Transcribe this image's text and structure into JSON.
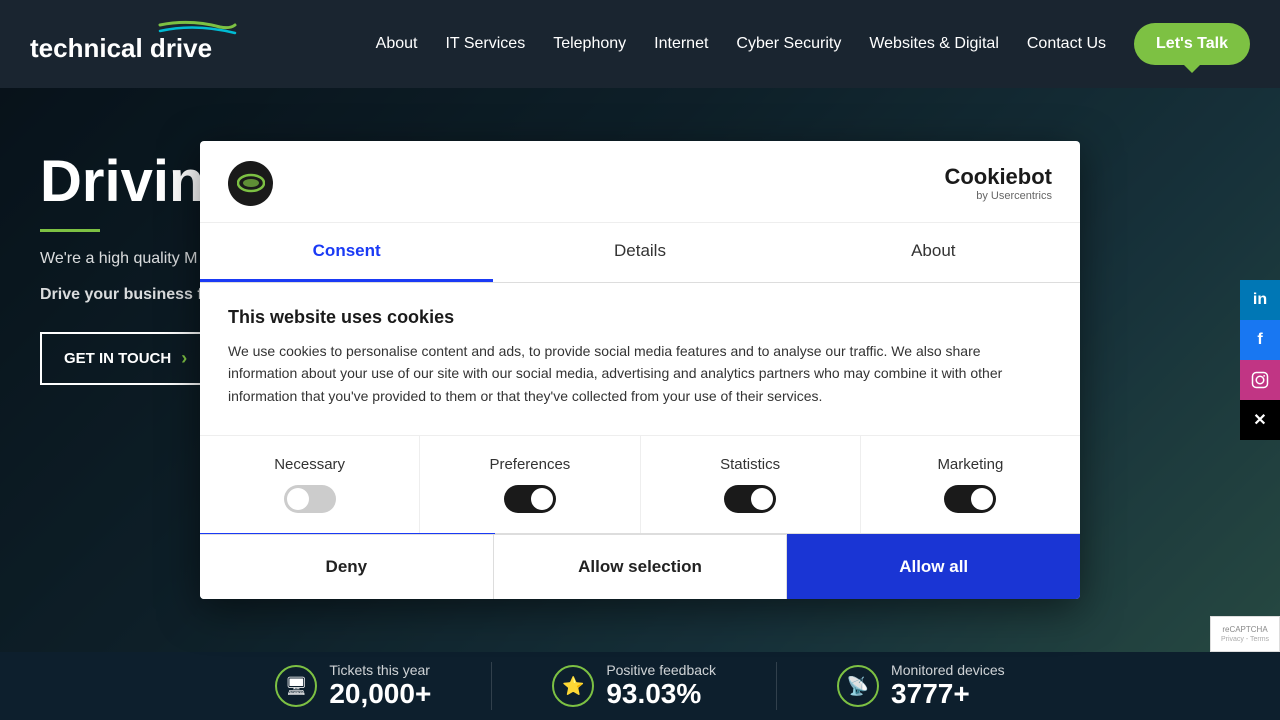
{
  "header": {
    "logo_text": "technical drive",
    "nav_items": [
      "About",
      "IT Services",
      "Telephony",
      "Internet",
      "Cyber Security",
      "Websites & Digital",
      "Contact Us"
    ],
    "cta_button": "Let's Talk"
  },
  "hero": {
    "title": "Driving",
    "description1": "We're a high quality M wide range of IT servi...",
    "description2": "Drive your business f... strategic team.",
    "cta": "GET IN TOUCH"
  },
  "social": {
    "items": [
      {
        "name": "linkedin",
        "icon": "in"
      },
      {
        "name": "facebook",
        "icon": "f"
      },
      {
        "name": "instagram",
        "icon": "◎"
      },
      {
        "name": "twitter-x",
        "icon": "✕"
      }
    ]
  },
  "stats": [
    {
      "icon": "🖥",
      "label": "Tickets this year",
      "value": "20,000+"
    },
    {
      "icon": "⭐",
      "label": "Positive feedback",
      "value": "93.03%"
    },
    {
      "icon": "📡",
      "label": "Monitored devices",
      "value": "3777+"
    }
  ],
  "cookie_modal": {
    "tabs": [
      "Consent",
      "Details",
      "About"
    ],
    "active_tab": "Consent",
    "title": "This website uses cookies",
    "description": "We use cookies to personalise content and ads, to provide social media features and to analyse our traffic. We also share information about your use of our site with our social media, advertising and analytics partners who may combine it with other information that you've provided to them or that they've collected from your use of their services.",
    "categories": [
      {
        "label": "Necessary",
        "state": "off"
      },
      {
        "label": "Preferences",
        "state": "on"
      },
      {
        "label": "Statistics",
        "state": "on"
      },
      {
        "label": "Marketing",
        "state": "on"
      }
    ],
    "buttons": {
      "deny": "Deny",
      "allow_selection": "Allow selection",
      "allow_all": "Allow all"
    },
    "cookiebot_brand": "Cookiebot",
    "cookiebot_sub": "by Usercentrics"
  }
}
